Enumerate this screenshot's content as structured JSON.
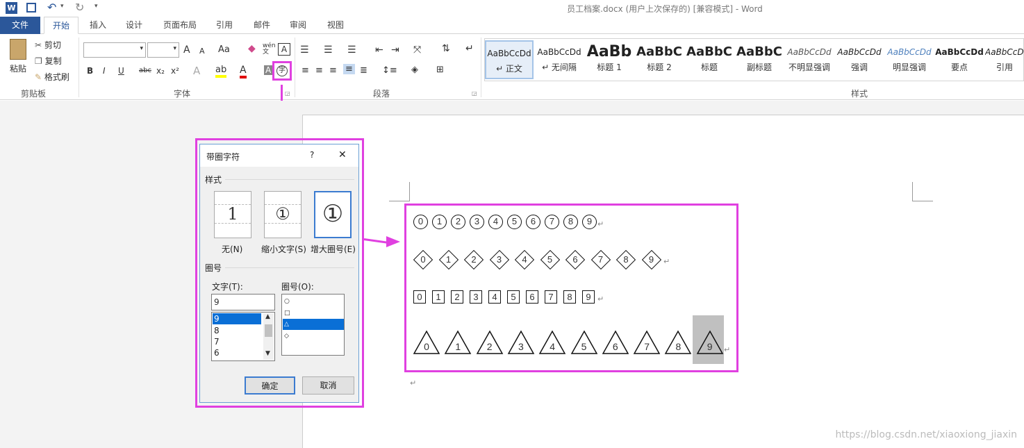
{
  "window": {
    "title": "员工档案.docx (用户上次保存的) [兼容模式] - Word"
  },
  "tabs": [
    "文件",
    "开始",
    "插入",
    "设计",
    "页面布局",
    "引用",
    "邮件",
    "审阅",
    "视图"
  ],
  "clipboard": {
    "paste": "粘贴",
    "cut": "剪切",
    "copy": "复制",
    "format_painter": "格式刷",
    "label": "剪贴板"
  },
  "font_group": {
    "label": "字体",
    "grow": "A",
    "shrink": "A",
    "change_case": "Aa",
    "bold": "B",
    "italic": "I",
    "underline": "U",
    "strike": "abc",
    "sub": "x₂",
    "sup": "x²",
    "enclose_glyph": "字",
    "phonetic": "wén文",
    "border_char": "A"
  },
  "paragraph_group": {
    "label": "段落"
  },
  "styles_group": {
    "label": "样式",
    "items": [
      {
        "preview": "AaBbCcDd",
        "name": "↵ 正文"
      },
      {
        "preview": "AaBbCcDd",
        "name": "↵ 无间隔"
      },
      {
        "preview": "AaBb",
        "name": "标题 1"
      },
      {
        "preview": "AaBbC",
        "name": "标题 2"
      },
      {
        "preview": "AaBbC",
        "name": "标题"
      },
      {
        "preview": "AaBbC",
        "name": "副标题"
      },
      {
        "preview": "AaBbCcDd",
        "name": "不明显强调"
      },
      {
        "preview": "AaBbCcDd",
        "name": "强调"
      },
      {
        "preview": "AaBbCcDd",
        "name": "明显强调"
      },
      {
        "preview": "AaBbCcDd",
        "name": "要点"
      },
      {
        "preview": "AaBbCcDd",
        "name": "引用"
      }
    ]
  },
  "dialog": {
    "title": "带圈字符",
    "help": "?",
    "close": "✕",
    "style_label": "样式",
    "styles": [
      {
        "label": "无(N)",
        "glyph": "1"
      },
      {
        "label": "缩小文字(S)",
        "glyph": "①"
      },
      {
        "label": "增大圈号(E)",
        "glyph": "①"
      }
    ],
    "enclosure_label": "圈号",
    "text_label": "文字(T):",
    "text_value": "9",
    "text_list": [
      "9",
      "8",
      "7",
      "6"
    ],
    "shape_label": "圈号(O):",
    "shape_list": [
      "○",
      "□",
      "△",
      "◇"
    ],
    "ok": "确定",
    "cancel": "取消"
  },
  "result": {
    "digits": [
      "0",
      "1",
      "2",
      "3",
      "4",
      "5",
      "6",
      "7",
      "8",
      "9"
    ],
    "circled": "⓪ ① ② ③ ④ ⑤ ⑥ ⑦ ⑧ ⑨",
    "return_mark": "↵"
  },
  "watermark": "https://blog.csdn.net/xiaoxiong_jiaxin",
  "colors": {
    "accent": "#2b579a",
    "highlight": "#e040e0",
    "selection": "#0a6fd6"
  }
}
